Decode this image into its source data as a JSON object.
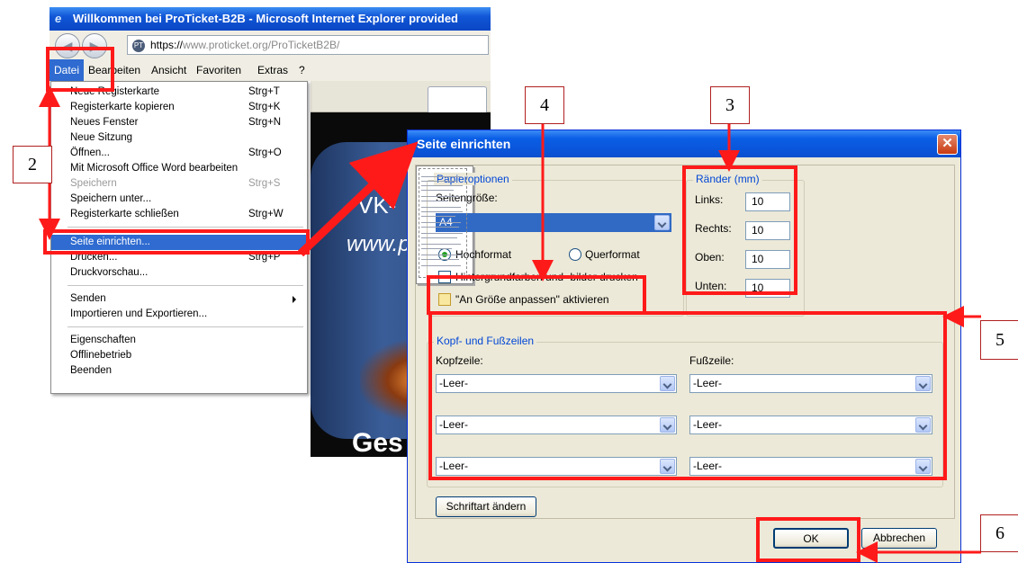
{
  "browser": {
    "title": "Willkommen bei ProTicket-B2B - Microsoft Internet Explorer provided",
    "address": {
      "scheme": "https://",
      "host": "www.proticket.org",
      "path": "/ProTicketB2B/"
    },
    "menubar": [
      "Datei",
      "Bearbeiten",
      "Ansicht",
      "Favoriten",
      "Extras",
      "?"
    ],
    "page_text": [
      "VK- ",
      "www.p",
      "Ges"
    ]
  },
  "file_menu": {
    "items": [
      {
        "label": "Neue Registerkarte",
        "shortcut": "Strg+T"
      },
      {
        "label": "Registerkarte kopieren",
        "shortcut": "Strg+K"
      },
      {
        "label": "Neues Fenster",
        "shortcut": "Strg+N"
      },
      {
        "label": "Neue Sitzung",
        "shortcut": ""
      },
      {
        "label": "Öffnen...",
        "shortcut": "Strg+O"
      },
      {
        "label": "Mit Microsoft Office Word bearbeiten",
        "shortcut": ""
      },
      {
        "label": "Speichern",
        "shortcut": "Strg+S"
      },
      {
        "label": "Speichern unter...",
        "shortcut": ""
      },
      {
        "label": "Registerkarte schließen",
        "shortcut": "Strg+W"
      },
      {
        "label": "Seite einrichten...",
        "shortcut": ""
      },
      {
        "label": "Drucken...",
        "shortcut": "Strg+P"
      },
      {
        "label": "Druckvorschau...",
        "shortcut": ""
      },
      {
        "label": "Senden",
        "shortcut": ""
      },
      {
        "label": "Importieren und Exportieren...",
        "shortcut": ""
      },
      {
        "label": "Eigenschaften",
        "shortcut": ""
      },
      {
        "label": "Offlinebetrieb",
        "shortcut": ""
      },
      {
        "label": "Beenden",
        "shortcut": ""
      }
    ]
  },
  "dialog": {
    "title": "Seite einrichten",
    "paper_options": {
      "legend": "Papieroptionen",
      "size_label": "Seitengröße:",
      "size_value": "A4",
      "portrait": "Hochformat",
      "landscape": "Querformat",
      "bg_label": "Hintergrundfarben und -bilder drucken",
      "shrink_label": "\"An Größe anpassen\" aktivieren"
    },
    "margins": {
      "legend": "Ränder (mm)",
      "left_label": "Links:",
      "left": "10",
      "right_label": "Rechts:",
      "right": "10",
      "top_label": "Oben:",
      "top": "10",
      "bottom_label": "Unten:",
      "bottom": "10"
    },
    "headers_footers": {
      "legend": "Kopf- und Fußzeilen",
      "header_label": "Kopfzeile:",
      "footer_label": "Fußzeile:",
      "header": [
        "-Leer-",
        "-Leer-",
        "-Leer-"
      ],
      "footer": [
        "-Leer-",
        "-Leer-",
        "-Leer-"
      ],
      "font_button": "Schriftart ändern"
    },
    "ok": "OK",
    "cancel": "Abbrechen"
  },
  "callouts": [
    "2",
    "4",
    "3",
    "5",
    "6"
  ],
  "colors": {
    "annotation": "#ff1a1a",
    "dialog_title": "#0a5ee6",
    "menu_highlight": "#2f6bd0"
  }
}
